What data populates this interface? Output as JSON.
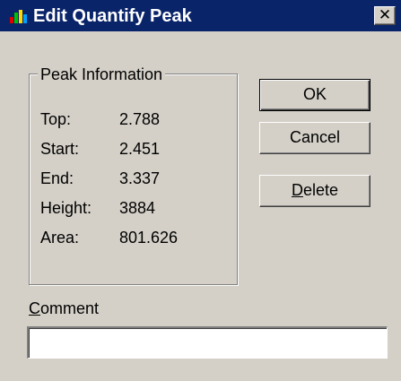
{
  "window": {
    "title": "Edit Quantify Peak",
    "app_icon": "chromatogram-app-icon",
    "close_glyph": "✕",
    "titlebar_color": "#0a246a"
  },
  "peak_info": {
    "group_label": "Peak Information",
    "rows": [
      {
        "label": "Top:",
        "value": "2.788"
      },
      {
        "label": "Start:",
        "value": "2.451"
      },
      {
        "label": "End:",
        "value": "3.337"
      },
      {
        "label": "Height:",
        "value": "3884"
      },
      {
        "label": "Area:",
        "value": "801.626"
      }
    ]
  },
  "buttons": {
    "ok_label": "OK",
    "cancel_label": "Cancel",
    "delete_accel": "D",
    "delete_rest": "elete"
  },
  "comment": {
    "label_accel": "C",
    "label_rest": "omment",
    "value": "",
    "placeholder": ""
  }
}
